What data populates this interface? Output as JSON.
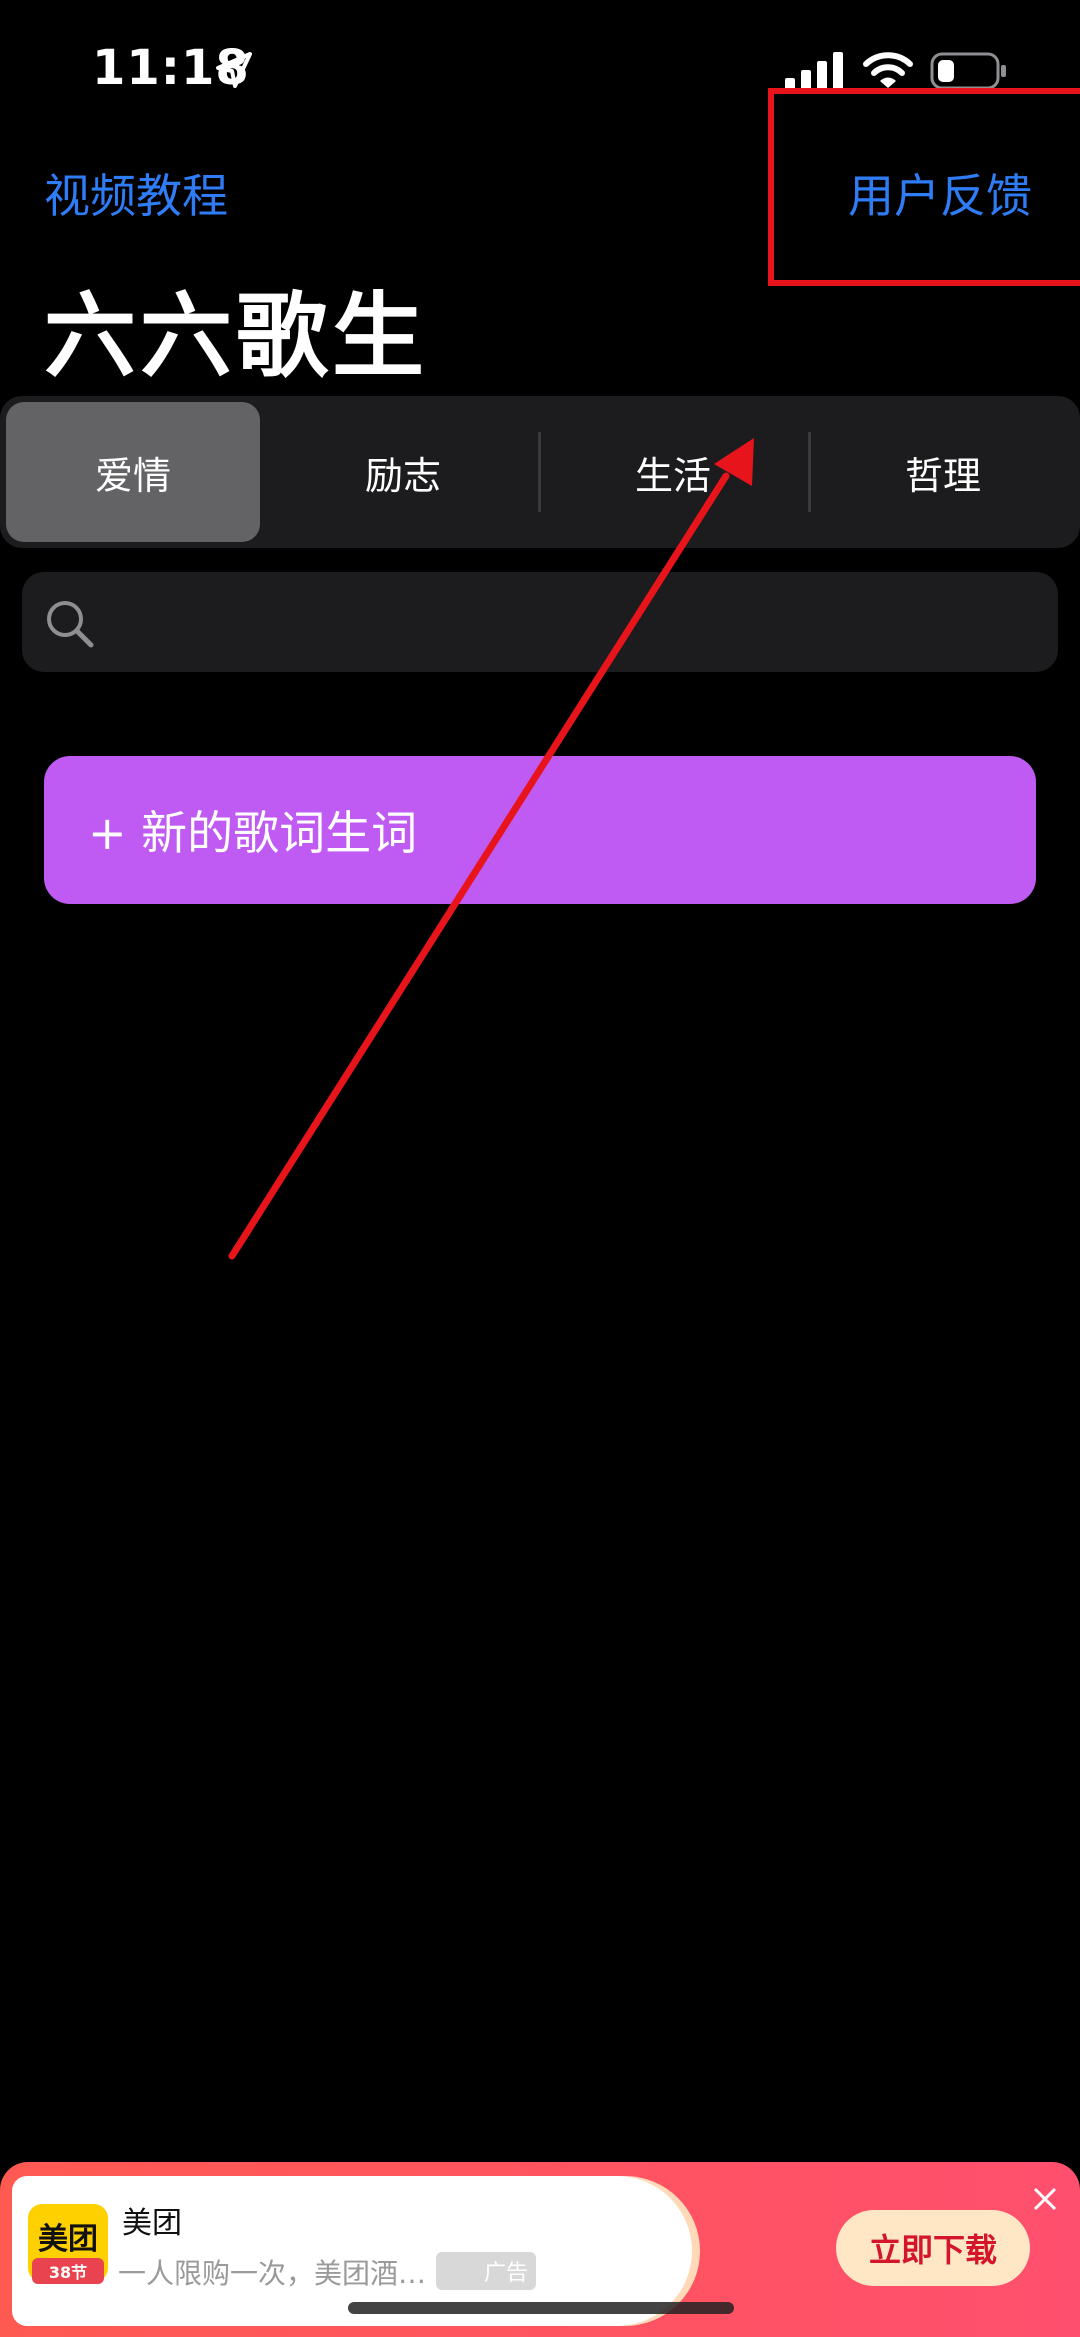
{
  "status_bar": {
    "time": "11:18",
    "icons": [
      "location-arrow-icon",
      "cellular-signal-icon",
      "wifi-icon",
      "battery-icon"
    ]
  },
  "nav": {
    "left_label": "视频教程",
    "right_label": "用户反馈",
    "link_color": "#2f7df6"
  },
  "page": {
    "title": "六六歌生"
  },
  "segments": {
    "items": [
      "爱情",
      "励志",
      "生活",
      "哲理"
    ],
    "selected": "爱情"
  },
  "search": {
    "value": "",
    "placeholder": ""
  },
  "new_button": {
    "label": "+ 新的歌词生词",
    "color": "#bf5af2"
  },
  "annotation": {
    "color": "#e8141b"
  },
  "ad": {
    "brand_logo_text": "美团",
    "brand_badge": "38节",
    "title": "美团",
    "description": "一人限购一次，美团酒…",
    "tag": "广告",
    "cta": "立即下载"
  }
}
